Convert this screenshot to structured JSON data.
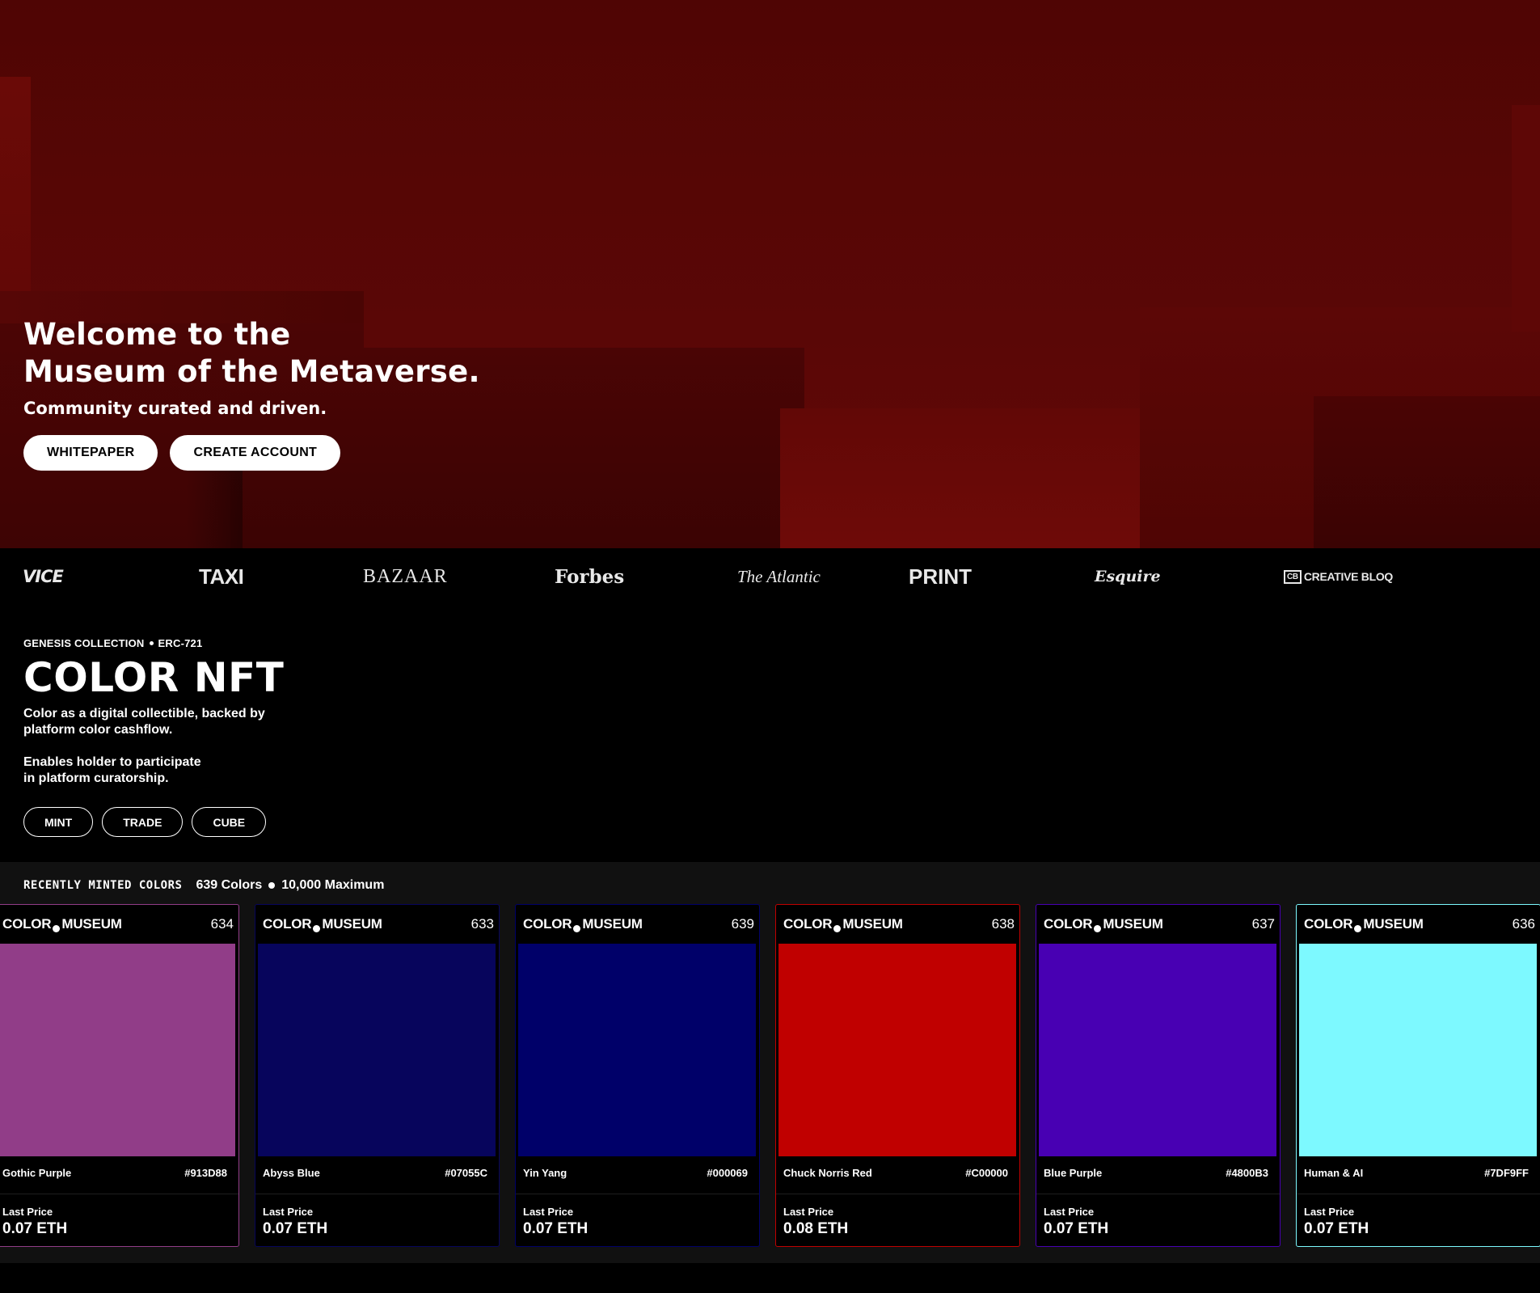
{
  "hero": {
    "title_line1": "Welcome to the",
    "title_line2": "Museum of the Metaverse.",
    "subtitle": "Community curated and driven.",
    "whitepaper_label": "WHITEPAPER",
    "create_account_label": "CREATE ACCOUNT"
  },
  "press": {
    "logos": [
      "VICE",
      "TAXI",
      "BAZAAR",
      "Forbes",
      "The Atlantic",
      "PRINT",
      "Esquire",
      "CREATIVE BLOQ"
    ],
    "creative_bloq_mark": "CB"
  },
  "genesis": {
    "eyebrow_left": "GENESIS COLLECTION",
    "eyebrow_right": "ERC-721",
    "title": "COLOR NFT",
    "desc1_line1": "Color as a digital collectible, backed by",
    "desc1_line2": "platform color cashflow.",
    "desc2_line1": "Enables holder to participate",
    "desc2_line2": "in platform curatorship.",
    "mint_label": "MINT",
    "trade_label": "TRADE",
    "cube_label": "CUBE"
  },
  "recent": {
    "label": "RECENTLY MINTED COLORS",
    "count": "639 Colors",
    "maximum": "10,000 Maximum"
  },
  "cards": [
    {
      "brand_left": "COLOR",
      "brand_right": "MUSEUM",
      "id": "634",
      "name": "Gothic Purple",
      "hex": "#913D88",
      "price_label": "Last Price",
      "price": "0.07 ETH",
      "border": "#913D88"
    },
    {
      "brand_left": "COLOR",
      "brand_right": "MUSEUM",
      "id": "633",
      "name": "Abyss Blue",
      "hex": "#07055C",
      "price_label": "Last Price",
      "price": "0.07 ETH",
      "border": "#07055C"
    },
    {
      "brand_left": "COLOR",
      "brand_right": "MUSEUM",
      "id": "639",
      "name": "Yin Yang",
      "hex": "#000069",
      "price_label": "Last Price",
      "price": "0.07 ETH",
      "border": "#000069"
    },
    {
      "brand_left": "COLOR",
      "brand_right": "MUSEUM",
      "id": "638",
      "name": "Chuck Norris Red",
      "hex": "#C00000",
      "price_label": "Last Price",
      "price": "0.08 ETH",
      "border": "#C00000"
    },
    {
      "brand_left": "COLOR",
      "brand_right": "MUSEUM",
      "id": "637",
      "name": "Blue Purple",
      "hex": "#4800B3",
      "price_label": "Last Price",
      "price": "0.07 ETH",
      "border": "#4800B3"
    },
    {
      "brand_left": "COLOR",
      "brand_right": "MUSEUM",
      "id": "636",
      "name": "Human & AI",
      "hex": "#7DF9FF",
      "price_label": "Last Price",
      "price": "0.07 ETH",
      "border": "#7DF9FF"
    }
  ],
  "colors": {
    "hero_red": "#560605",
    "background": "#000000",
    "section_bg": "#111111"
  }
}
